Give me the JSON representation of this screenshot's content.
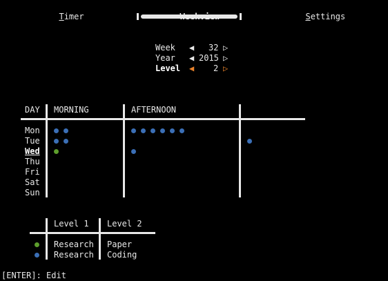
{
  "tabs": [
    {
      "hot": "T",
      "rest": "imer",
      "active": false
    },
    {
      "hot": "",
      "rest": "Weekview",
      "active": true
    },
    {
      "hot": "S",
      "rest": "ettings",
      "active": false
    }
  ],
  "selector": {
    "week": {
      "label": "Week",
      "value": "32"
    },
    "year": {
      "label": "Year",
      "value": "2015"
    },
    "level": {
      "label": "Level",
      "value": "2"
    }
  },
  "icons": {
    "left_arrow": "◀",
    "right_arrow": "▷"
  },
  "grid": {
    "headers": {
      "day": "DAY",
      "morning": "MORNING",
      "afternoon": "AFTERNOON"
    },
    "days": [
      "Mon",
      "Tue",
      "Wed",
      "Thu",
      "Fri",
      "Sat",
      "Sun"
    ],
    "today_index": 2,
    "entries": {
      "Mon": {
        "morning": [
          "blue",
          "blue"
        ],
        "afternoon": [
          "blue",
          "blue",
          "blue",
          "blue",
          "blue",
          "blue"
        ],
        "evening": []
      },
      "Tue": {
        "morning": [
          "blue",
          "blue"
        ],
        "afternoon": [],
        "evening": [
          "blue"
        ]
      },
      "Wed": {
        "morning": [
          "green"
        ],
        "afternoon": [
          "blue"
        ],
        "evening": []
      }
    }
  },
  "legend": {
    "headers": {
      "level1": "Level 1",
      "level2": "Level 2"
    },
    "rows": [
      {
        "color": "green",
        "level1": "Research",
        "level2": "Paper"
      },
      {
        "color": "blue",
        "level1": "Research",
        "level2": "Coding"
      }
    ]
  },
  "colors": {
    "blue": "#3b6fb6",
    "green": "#5d9e2c",
    "accent": "#e8822b"
  },
  "footer": {
    "hint": "[ENTER]: Edit"
  }
}
